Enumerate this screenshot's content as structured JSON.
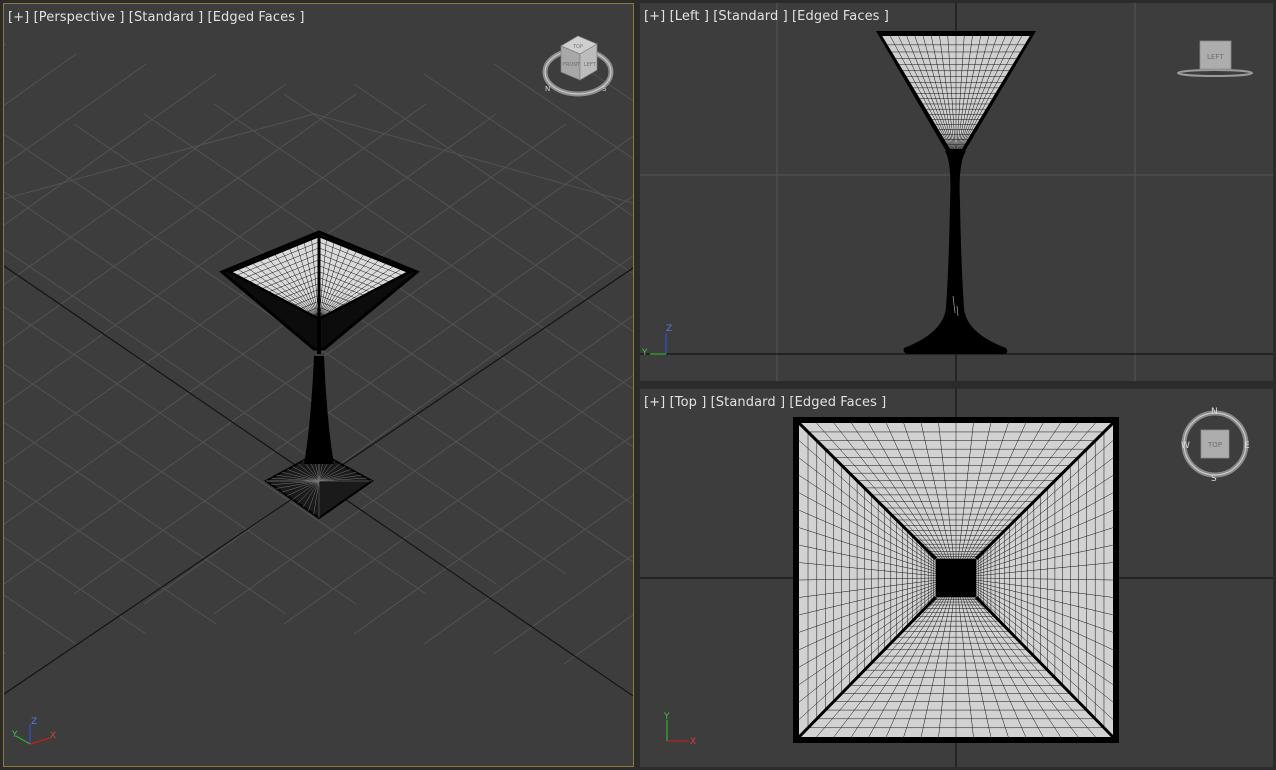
{
  "viewports": {
    "perspective": {
      "plus": "[+]",
      "view": "[Perspective ]",
      "shading": "[Standard ]",
      "faces": "[Edged Faces ]",
      "viewcube_faces": {
        "top": "TOP",
        "front": "FRONT",
        "left": "LEFT"
      },
      "compass": {
        "n": "N",
        "s": "S"
      },
      "axis": {
        "z": "Z",
        "y": "Y",
        "x": "X"
      }
    },
    "left": {
      "plus": "[+]",
      "view": "[Left ]",
      "shading": "[Standard ]",
      "faces": "[Edged Faces ]",
      "viewcube_label": "LEFT",
      "axis": {
        "z": "Z",
        "y": "Y"
      }
    },
    "top": {
      "plus": "[+]",
      "view": "[Top ]",
      "shading": "[Standard ]",
      "faces": "[Edged Faces ]",
      "viewcube_label": "TOP",
      "compass": {
        "n": "N",
        "s": "S",
        "e": "E",
        "w": "W"
      },
      "axis": {
        "y": "Y",
        "x": "X"
      }
    }
  },
  "colors": {
    "viewport_bg": "#3d3d3d",
    "active_border": "#8c7a3a",
    "grid_line": "#4f4f4f",
    "home_grid_axis": "#111111",
    "model_wire": "#000000",
    "axis_x": "#c02020",
    "axis_y": "#30b030",
    "axis_z": "#3050d0"
  }
}
